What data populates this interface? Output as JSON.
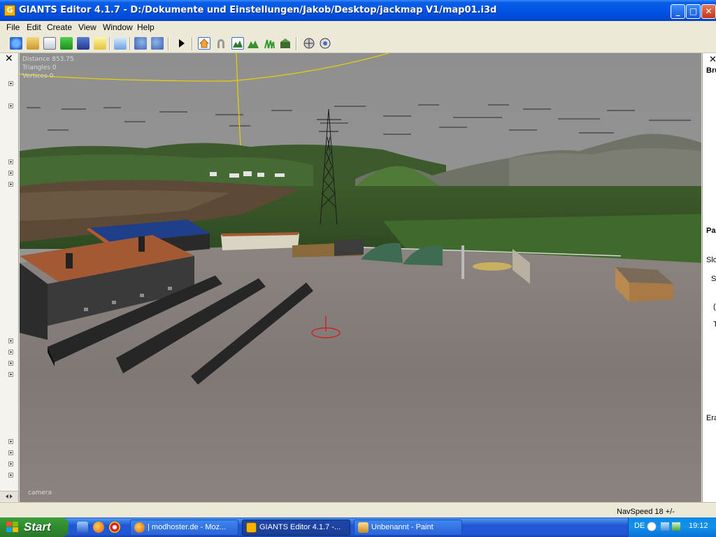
{
  "window": {
    "title": "GIANTS Editor 4.1.7 - D:/Dokumente und Einstellungen/Jakob/Desktop/jackmap V1/map01.i3d",
    "icon_letter": "G",
    "minimize": "_",
    "maximize": "□",
    "close": "✕"
  },
  "menu": {
    "file": "File",
    "edit": "Edit",
    "create": "Create",
    "view": "View",
    "window": "Window",
    "help": "Help"
  },
  "left_panel": {
    "close": "✕"
  },
  "right_panel": {
    "close": "✕",
    "labels": [
      "Bru",
      "Pa",
      "Slo",
      "S",
      "(",
      "T",
      "Era"
    ]
  },
  "viewport": {
    "hud_distance": "Distance 853.75",
    "hud_triangles": "Triangles 0",
    "hud_vertices": "Vertices 0",
    "camera_label": "camera"
  },
  "status": {
    "navspeed": "NavSpeed 18 +/-"
  },
  "taskbar": {
    "start": "Start",
    "tasks": [
      "| modhoster.de - Moz...",
      "GIANTS Editor 4.1.7 -...",
      "Unbenannt - Paint"
    ],
    "language": "DE",
    "clock": "19:12"
  }
}
